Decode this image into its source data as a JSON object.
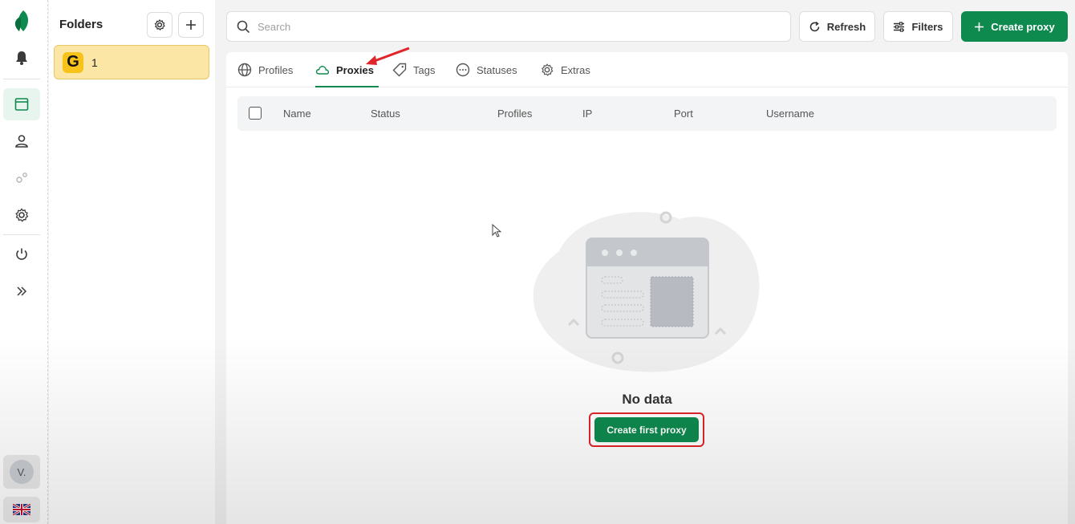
{
  "folders": {
    "title": "Folders",
    "items": [
      {
        "logo": "G",
        "name": "1"
      }
    ]
  },
  "search": {
    "placeholder": "Search",
    "value": ""
  },
  "toolbar": {
    "refresh_label": "Refresh",
    "filters_label": "Filters",
    "create_label": "Create proxy"
  },
  "tabs": [
    {
      "label": "Profiles",
      "icon": "globe-icon"
    },
    {
      "label": "Proxies",
      "icon": "cloud-icon",
      "active": true
    },
    {
      "label": "Tags",
      "icon": "tag-icon"
    },
    {
      "label": "Statuses",
      "icon": "dots-circle-icon"
    },
    {
      "label": "Extras",
      "icon": "gear-icon"
    }
  ],
  "table": {
    "columns": [
      "Name",
      "Status",
      "Profiles",
      "IP",
      "Port",
      "Username"
    ],
    "rows": []
  },
  "empty": {
    "text": "No data",
    "button_label": "Create first proxy"
  },
  "user": {
    "initials": "V."
  },
  "colors": {
    "accent": "#0e8a4f",
    "folder_bg": "#fbe6a6",
    "highlight": "#e0252b"
  }
}
